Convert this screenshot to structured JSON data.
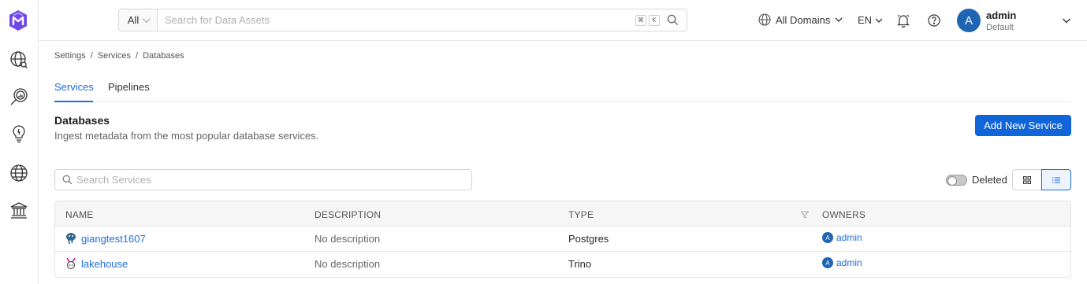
{
  "header": {
    "search": {
      "scope": "All",
      "placeholder": "Search for Data Assets",
      "shortcut_keys": [
        "⌘",
        "K"
      ]
    },
    "domains_label": "All Domains",
    "language": "EN",
    "user": {
      "initial": "A",
      "name": "admin",
      "role": "Default"
    }
  },
  "sidebar": {
    "items": [
      {
        "icon": "explore-icon"
      },
      {
        "icon": "data-quality-icon"
      },
      {
        "icon": "insights-icon"
      },
      {
        "icon": "domains-icon"
      },
      {
        "icon": "governance-icon"
      }
    ]
  },
  "breadcrumb": [
    "Settings",
    "Services",
    "Databases"
  ],
  "tabs": [
    {
      "label": "Services",
      "active": true
    },
    {
      "label": "Pipelines",
      "active": false
    }
  ],
  "section": {
    "title": "Databases",
    "description": "Ingest metadata from the most popular database services.",
    "add_button": "Add New Service"
  },
  "services_search": {
    "placeholder": "Search Services"
  },
  "deleted_toggle": {
    "label": "Deleted",
    "on": false
  },
  "table": {
    "columns": [
      "NAME",
      "DESCRIPTION",
      "TYPE",
      "OWNERS"
    ],
    "rows": [
      {
        "name": "giangtest1607",
        "description": "No description",
        "type": "Postgres",
        "owner": "admin",
        "owner_initial": "A",
        "icon": "postgres-icon"
      },
      {
        "name": "lakehouse",
        "description": "No description",
        "type": "Trino",
        "owner": "admin",
        "owner_initial": "A",
        "icon": "trino-icon"
      }
    ]
  },
  "colors": {
    "accent": "#1f6ee0",
    "button": "#1065d8",
    "avatar": "#1f65b1",
    "logo": "#7147e8"
  }
}
